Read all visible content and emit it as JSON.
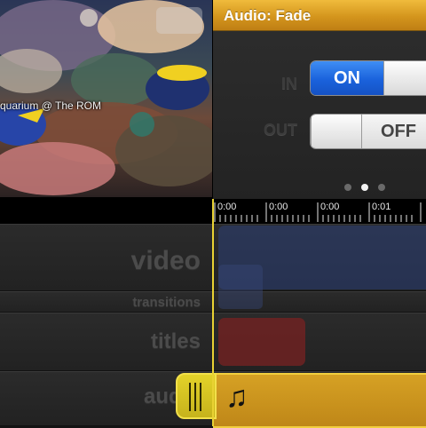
{
  "preview": {
    "caption": "quarium @ The ROM"
  },
  "fade_panel": {
    "title": "Audio: Fade",
    "in": {
      "label": "IN",
      "value_label": "ON",
      "state": "on"
    },
    "out": {
      "label": "OUT",
      "value_label": "OFF",
      "state": "off"
    },
    "pages": {
      "count": 3,
      "active": 2
    }
  },
  "ruler": {
    "ticks": [
      "0:00",
      "0:00",
      "0:00",
      "0:01"
    ]
  },
  "tracks": {
    "video": "video",
    "transitions": "transitions",
    "titles": "titles",
    "audio": "audio"
  },
  "colors": {
    "accent_gold": "#d4951d",
    "toggle_blue": "#1a62dc",
    "playhead": "#e9d233"
  },
  "icons": {
    "audio_clip": "music-note-icon",
    "grip": "drag-handle-icon"
  }
}
